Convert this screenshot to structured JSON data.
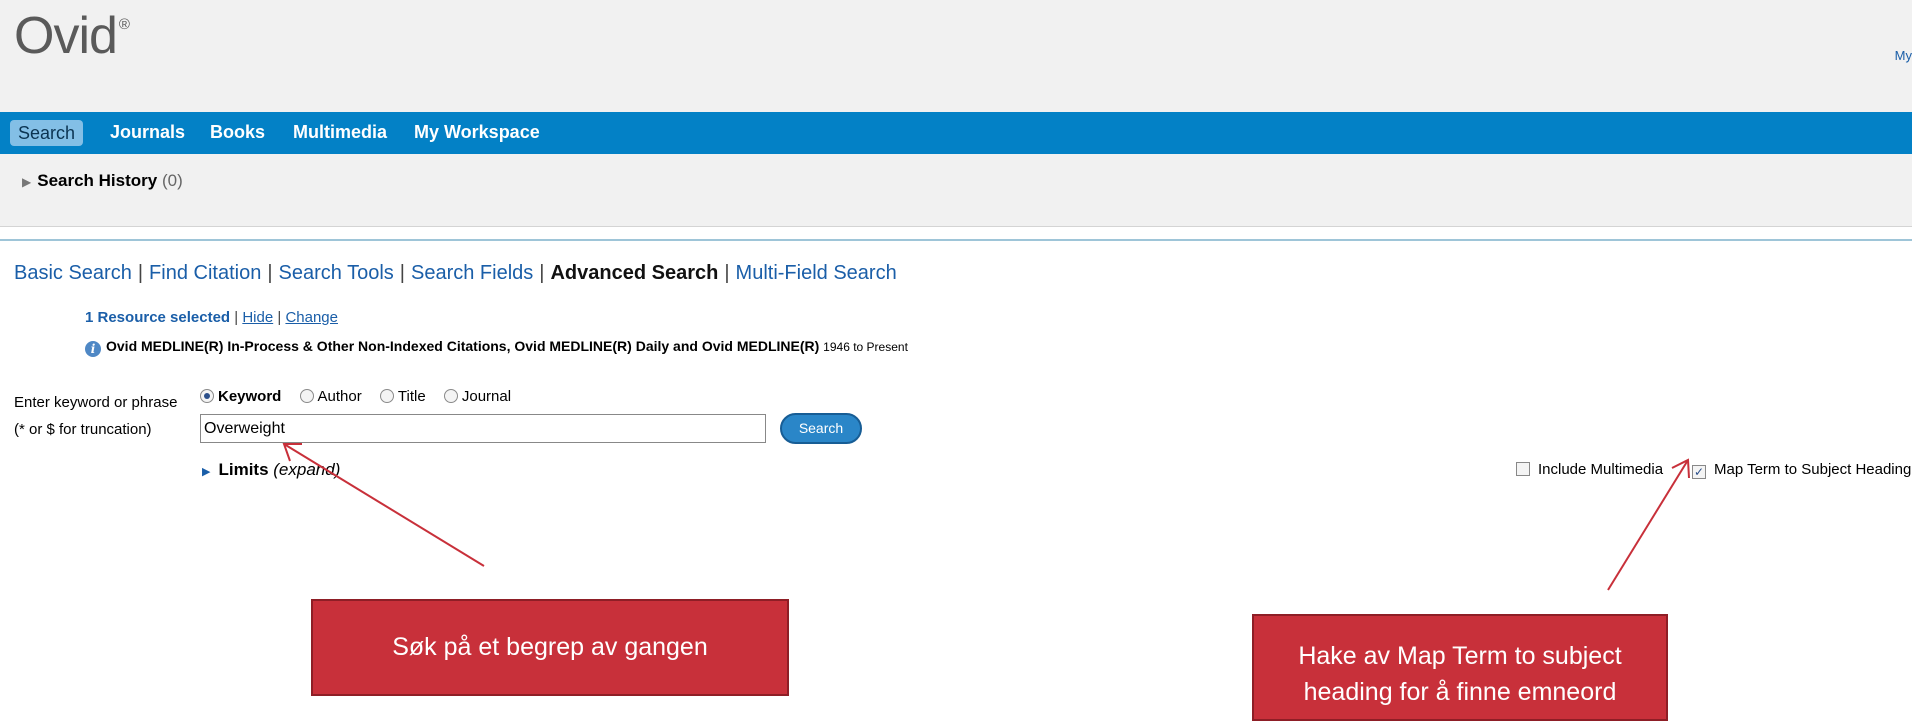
{
  "header": {
    "logo_text": "Ovid",
    "logo_mark": "®",
    "my_link": "My"
  },
  "nav": {
    "items": [
      {
        "label": "Search",
        "active": true
      },
      {
        "label": "Journals",
        "active": false
      },
      {
        "label": "Books",
        "active": false
      },
      {
        "label": "Multimedia",
        "active": false
      },
      {
        "label": "My Workspace",
        "active": false
      }
    ]
  },
  "history": {
    "label": "Search History",
    "count": "(0)"
  },
  "search_tabs": [
    {
      "label": "Basic Search",
      "current": false
    },
    {
      "label": "Find Citation",
      "current": false
    },
    {
      "label": "Search Tools",
      "current": false
    },
    {
      "label": "Search Fields",
      "current": false
    },
    {
      "label": "Advanced Search",
      "current": true
    },
    {
      "label": "Multi-Field Search",
      "current": false
    }
  ],
  "resource": {
    "selected_text": "1 Resource selected",
    "hide_label": "Hide",
    "change_label": "Change",
    "database_name": "Ovid MEDLINE(R) In-Process & Other Non-Indexed Citations, Ovid MEDLINE(R) Daily and Ovid MEDLINE(R)",
    "database_years": "1946 to Present"
  },
  "search_form": {
    "label_line1": "Enter keyword or phrase",
    "label_line2": "(* or $ for truncation)",
    "field_options": [
      {
        "label": "Keyword",
        "selected": true
      },
      {
        "label": "Author",
        "selected": false
      },
      {
        "label": "Title",
        "selected": false
      },
      {
        "label": "Journal",
        "selected": false
      }
    ],
    "query_value": "Overweight",
    "search_button": "Search",
    "limits_label": "Limits",
    "limits_expand": "(expand)",
    "include_multimedia": {
      "label": "Include Multimedia",
      "checked": false
    },
    "map_term": {
      "label": "Map Term to Subject Heading",
      "checked": true
    }
  },
  "annotations": {
    "callout_left": "Søk på et begrep av gangen",
    "callout_right_line1": "Hake av Map Term to subject",
    "callout_right_line2": "heading for å finne emneord",
    "color": "#c8303a"
  },
  "colors": {
    "nav_bar": "#0381c6",
    "link": "#1a5ea8",
    "annotation_red": "#c8303a"
  }
}
